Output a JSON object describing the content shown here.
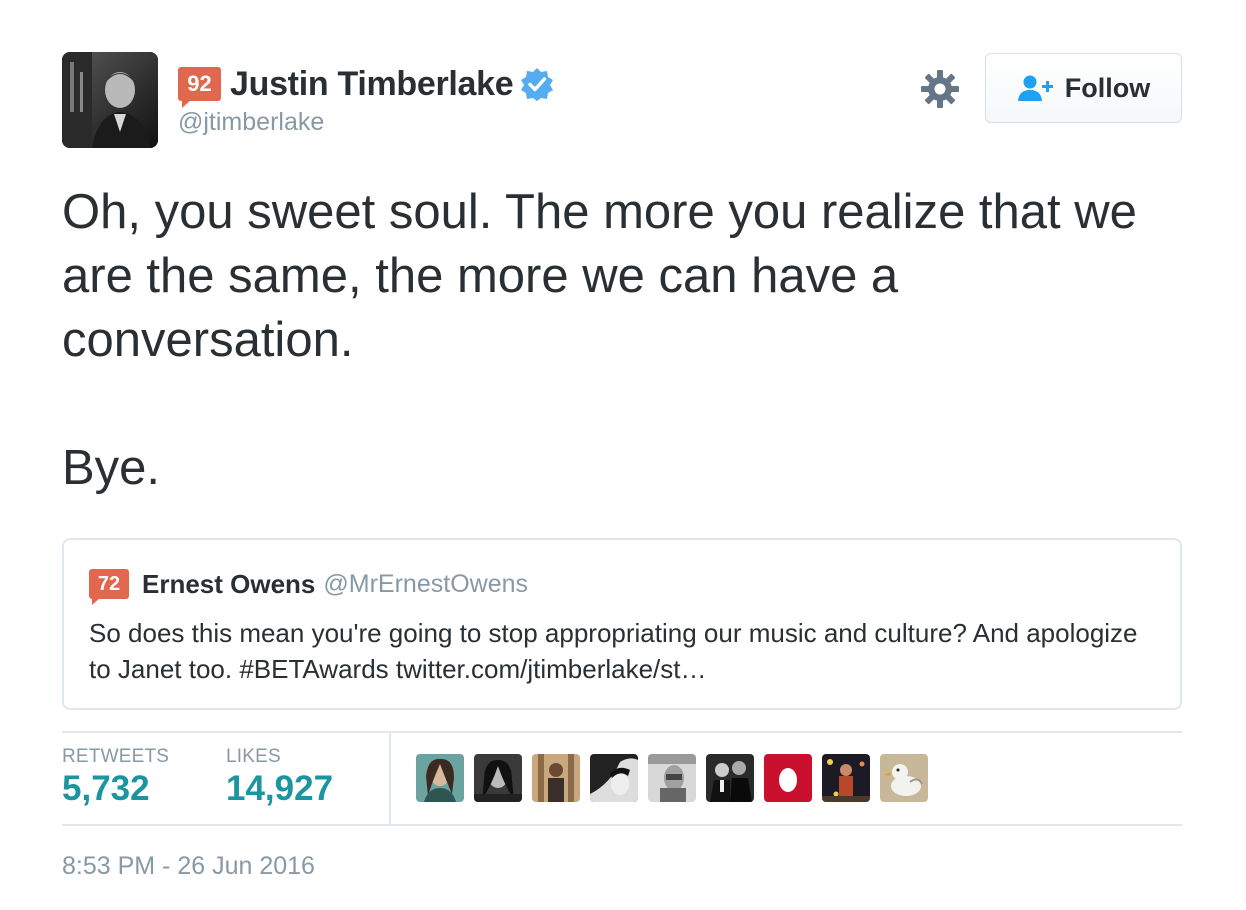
{
  "author": {
    "score": "92",
    "name": "Justin Timberlake",
    "handle": "@jtimberlake",
    "verified": true,
    "avatar_icon": "profile-photo"
  },
  "actions": {
    "settings_icon": "gear-icon",
    "follow_label": "Follow",
    "follow_icon": "add-user-icon"
  },
  "tweet": {
    "line1": "Oh, you sweet soul. The more you realize that we are the same, the more we can have a conversation.",
    "line2": "Bye."
  },
  "quoted": {
    "score": "72",
    "name": "Ernest Owens",
    "handle": "@MrErnestOwens",
    "text": "So does this mean you're going to stop appropriating our music and culture? And apologize to Janet too. #BETAwards twitter.com/jtimberlake/st…"
  },
  "stats": {
    "retweets_label": "RETWEETS",
    "retweets_value": "5,732",
    "likes_label": "LIKES",
    "likes_value": "14,927"
  },
  "likers": [
    "liker-avatar",
    "liker-avatar",
    "liker-avatar",
    "liker-avatar",
    "liker-avatar",
    "liker-avatar",
    "egg-avatar",
    "liker-avatar",
    "duck-avatar"
  ],
  "timestamp": "8:53 PM - 26 Jun 2016",
  "colors": {
    "badge": "#e2674f",
    "verified": "#55acee",
    "stat_value": "#1b95a0",
    "muted": "#8899a6",
    "follow_icon": "#1da1f2"
  }
}
